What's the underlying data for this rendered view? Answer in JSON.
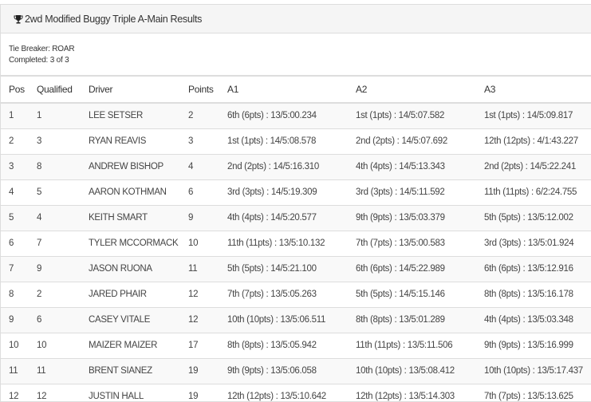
{
  "panel": {
    "title": "2wd Modified Buggy Triple A-Main Results",
    "title_icon": "trophy-icon"
  },
  "info": {
    "tie_breaker": "Tie Breaker: ROAR",
    "completed": "Completed: 3 of 3"
  },
  "table": {
    "headers": [
      "Pos",
      "Qualified",
      "Driver",
      "Points",
      "A1",
      "A2",
      "A3"
    ],
    "rows": [
      [
        "1",
        "1",
        "LEE SETSER",
        "2",
        "6th (6pts) : 13/5:00.234",
        "1st (1pts) : 14/5:07.582",
        "1st (1pts) : 14/5:09.817"
      ],
      [
        "2",
        "3",
        "RYAN REAVIS",
        "3",
        "1st (1pts) : 14/5:08.578",
        "2nd (2pts) : 14/5:07.692",
        "12th (12pts) : 4/1:43.227"
      ],
      [
        "3",
        "8",
        "ANDREW BISHOP",
        "4",
        "2nd (2pts) : 14/5:16.310",
        "4th (4pts) : 14/5:13.343",
        "2nd (2pts) : 14/5:22.241"
      ],
      [
        "4",
        "5",
        "AARON KOTHMAN",
        "6",
        "3rd (3pts) : 14/5:19.309",
        "3rd (3pts) : 14/5:11.592",
        "11th (11pts) : 6/2:24.755"
      ],
      [
        "5",
        "4",
        "KEITH SMART",
        "9",
        "4th (4pts) : 14/5:20.577",
        "9th (9pts) : 13/5:03.379",
        "5th (5pts) : 13/5:12.002"
      ],
      [
        "6",
        "7",
        "TYLER MCCORMACK",
        "10",
        "11th (11pts) : 13/5:10.132",
        "7th (7pts) : 13/5:00.583",
        "3rd (3pts) : 13/5:01.924"
      ],
      [
        "7",
        "9",
        "JASON RUONA",
        "11",
        "5th (5pts) : 14/5:21.100",
        "6th (6pts) : 14/5:22.989",
        "6th (6pts) : 13/5:12.916"
      ],
      [
        "8",
        "2",
        "JARED PHAIR",
        "12",
        "7th (7pts) : 13/5:05.263",
        "5th (5pts) : 14/5:15.146",
        "8th (8pts) : 13/5:16.178"
      ],
      [
        "9",
        "6",
        "CASEY VITALE",
        "12",
        "10th (10pts) : 13/5:06.511",
        "8th (8pts) : 13/5:01.289",
        "4th (4pts) : 13/5:03.348"
      ],
      [
        "10",
        "10",
        "MAIZER MAIZER",
        "17",
        "8th (8pts) : 13/5:05.942",
        "11th (11pts) : 13/5:11.506",
        "9th (9pts) : 13/5:16.999"
      ],
      [
        "11",
        "11",
        "BRENT SIANEZ",
        "19",
        "9th (9pts) : 13/5:06.058",
        "10th (10pts) : 13/5:08.412",
        "10th (10pts) : 13/5:17.437"
      ],
      [
        "12",
        "12",
        "JUSTIN HALL",
        "19",
        "12th (12pts) : 13/5:10.642",
        "12th (12pts) : 13/5:14.303",
        "7th (7pts) : 13/5:13.625"
      ]
    ]
  }
}
